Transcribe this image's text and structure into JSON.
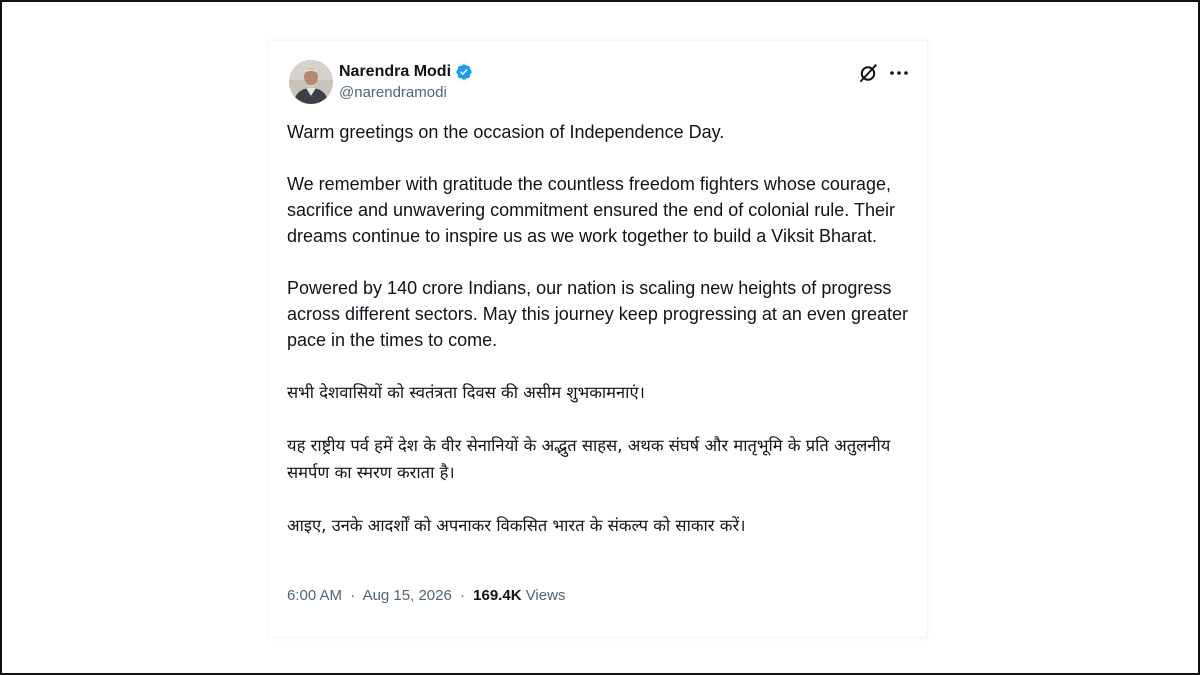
{
  "tweet": {
    "author": {
      "display_name": "Narendra Modi",
      "handle": "@narendramodi",
      "verified": true,
      "verified_color": "#1d9bf0",
      "avatar_icon": "profile-photo"
    },
    "header_icons": {
      "grok": "grok-icon",
      "more": "more-options-icon"
    },
    "paragraphs": [
      "Warm greetings on the occasion of Independence Day.",
      "We remember with gratitude the countless freedom fighters whose courage, sacrifice and unwavering commitment ensured the end of colonial rule. Their dreams continue to inspire us as we work together to build a Viksit Bharat.",
      "Powered by 140 crore Indians, our nation is scaling new heights of progress across different sectors. May this journey keep progressing at an even greater pace in the times to come.",
      "सभी देशवासियों को स्वतंत्रता दिवस की असीम शुभकामनाएं।",
      "यह राष्ट्रीय पर्व हमें देश के वीर सेनानियों के अद्भुत साहस, अथक संघर्ष और मातृभूमि के प्रति अतुलनीय समर्पण का स्मरण कराता है।",
      "आइए, उनके आदर्शों को अपनाकर विकसित भारत के संकल्प को साकार करें।"
    ],
    "meta": {
      "time": "6:00 AM",
      "separator": "·",
      "date": "Aug 15, 2026",
      "views_count": "169.4K",
      "views_label": "Views"
    }
  }
}
